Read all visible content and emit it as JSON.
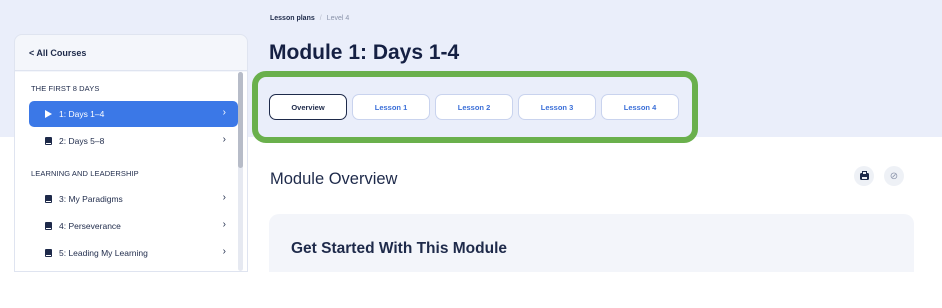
{
  "sidebar": {
    "back_label": "< All Courses",
    "sections": [
      {
        "label": "THE FIRST 8 DAYS"
      },
      {
        "label": "LEARNING AND LEADERSHIP"
      }
    ],
    "items": [
      {
        "label": "1: Days 1–4",
        "icon": "play-icon",
        "active": true
      },
      {
        "label": "2: Days 5–8",
        "icon": "book-icon"
      },
      {
        "label": "3: My Paradigms",
        "icon": "book-icon"
      },
      {
        "label": "4: Perseverance",
        "icon": "book-icon"
      },
      {
        "label": "5: Leading My Learning",
        "icon": "book-icon"
      }
    ],
    "chevron": "›"
  },
  "breadcrumb": {
    "link": "Lesson plans",
    "separator": "/",
    "current": "Level 4"
  },
  "page_title": "Module 1: Days 1-4",
  "tabs": [
    {
      "label": "Overview",
      "active": true
    },
    {
      "label": "Lesson 1"
    },
    {
      "label": "Lesson 2"
    },
    {
      "label": "Lesson 3"
    },
    {
      "label": "Lesson 4"
    }
  ],
  "overview": {
    "title": "Module Overview",
    "actions": [
      "printer-icon",
      "link-icon"
    ]
  },
  "card": {
    "title": "Get Started With This Module"
  },
  "colors": {
    "accent": "#3b78e7",
    "highlight": "#6ab04c",
    "header_band": "#eaeefa"
  }
}
